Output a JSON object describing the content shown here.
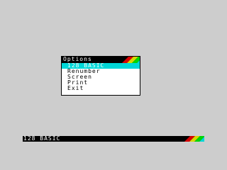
{
  "menu": {
    "title": "Options",
    "items": [
      {
        "label": "128 BASIC",
        "selected": true
      },
      {
        "label": "Renumber",
        "selected": false
      },
      {
        "label": "Screen",
        "selected": false
      },
      {
        "label": "Print",
        "selected": false
      },
      {
        "label": "Exit",
        "selected": false
      }
    ]
  },
  "status_bar": {
    "label": "128 BASIC"
  },
  "colors": {
    "background": "#cdcdcd",
    "menu_bg": "#ffffff",
    "header_bg": "#000000",
    "selected_bg": "#00d7d7",
    "stripe_red": "#d70000",
    "stripe_yellow": "#d7d700",
    "stripe_green": "#00d700",
    "stripe_cyan": "#00d7d7"
  }
}
